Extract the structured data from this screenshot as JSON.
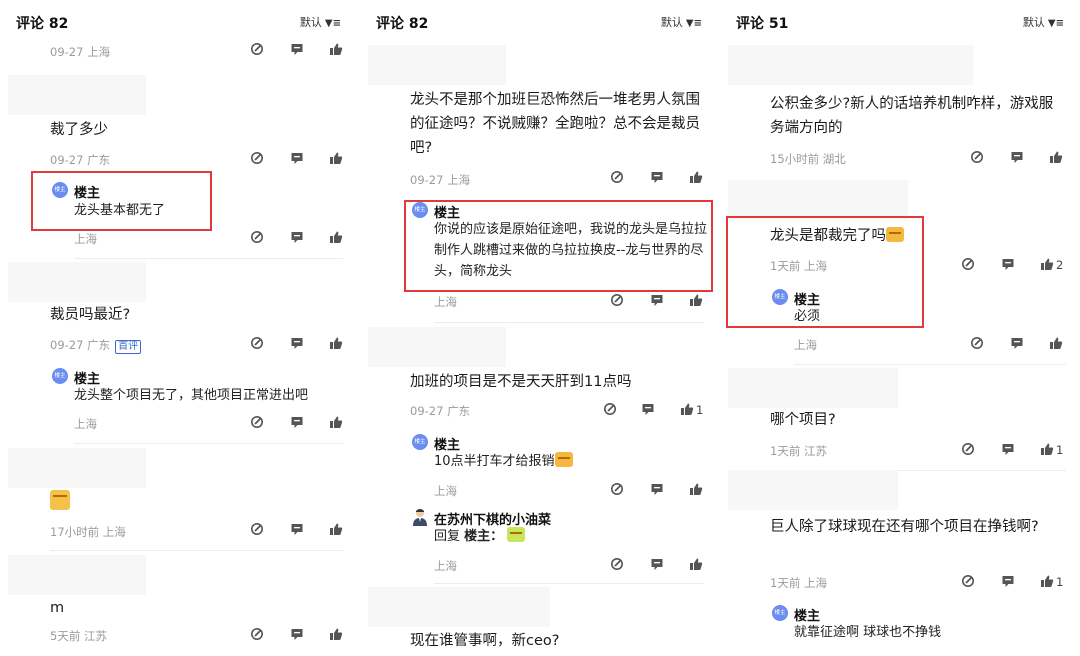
{
  "icons": {
    "edit": "edit-icon",
    "comment": "comment-icon",
    "like": "thumbs-up-icon",
    "sort": "filter-icon"
  },
  "colors": {
    "highlight": "#e23a3a",
    "owner_badge": "#6b8cf0",
    "badge_blue": "#3a6ad6"
  },
  "owner_badge_text": "楼主",
  "panels": [
    {
      "title": "评论 82",
      "sort_label": "默认",
      "comments": [
        {
          "meta": "09-27 上海"
        },
        {
          "text": "裁了多少",
          "meta": "09-27 广东",
          "reply": {
            "name": "楼主",
            "text": "龙头基本都无了",
            "meta": "上海"
          }
        },
        {
          "text": "裁员吗最近?",
          "meta": "09-27 广东",
          "badge": "首评",
          "reply": {
            "name": "楼主",
            "text": "龙头整个项目无了，其他项目正常进出吧",
            "meta": "上海"
          }
        },
        {
          "meta": "17小时前 上海"
        },
        {
          "text": "m",
          "meta": "5天前 江苏"
        }
      ]
    },
    {
      "title": "评论 82",
      "sort_label": "默认",
      "comments": [
        {
          "text": "龙头不是那个加班巨恐怖然后一堆老男人氛围的征途吗？不说贼赚？全跑啦？总不会是裁员吧?",
          "meta": "09-27 上海",
          "reply": {
            "name": "楼主",
            "text": "你说的应该是原始征途吧，我说的龙头是乌拉拉制作人跳槽过来做的乌拉拉换皮--龙与世界的尽头，简称龙头",
            "meta": "上海"
          }
        },
        {
          "text": "加班的项目是不是天天肝到11点吗",
          "meta": "09-27 广东",
          "likes": "1",
          "reply": {
            "name": "楼主",
            "text": "10点半打车才给报销",
            "meta": "上海"
          },
          "reply2": {
            "name": "在苏州下棋的小油菜",
            "prefix": "回复",
            "target": "楼主：",
            "meta": "上海"
          }
        },
        {
          "text": "现在谁管事啊，新ceo?"
        }
      ]
    },
    {
      "title": "评论 51",
      "sort_label": "默认",
      "comments": [
        {
          "text": "公积金多少?新人的话培养机制咋样，游戏服务端方向的",
          "meta": "15小时前 湖北"
        },
        {
          "text": "龙头是都裁完了吗",
          "meta": "1天前 上海",
          "likes": "2",
          "reply": {
            "name": "楼主",
            "text": "必须",
            "meta": "上海"
          }
        },
        {
          "text": "哪个项目?",
          "meta": "1天前 江苏",
          "likes": "1"
        },
        {
          "text": "巨人除了球球现在还有哪个项目在挣钱啊?",
          "meta": "1天前 上海",
          "likes": "1",
          "reply": {
            "name": "楼主",
            "text": "就靠征途啊 球球也不挣钱"
          }
        }
      ]
    }
  ]
}
